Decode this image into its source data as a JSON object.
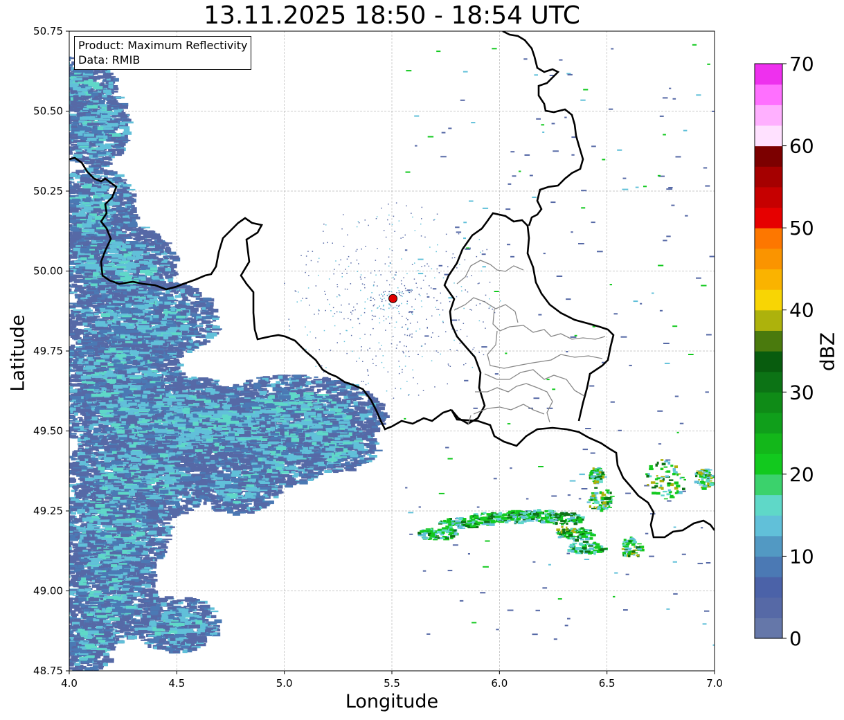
{
  "title": "13.11.2025 18:50 - 18:54 UTC",
  "info_box": {
    "product_line": "Product: Maximum Reflectivity",
    "data_line": "Data: RMIB"
  },
  "axes": {
    "xlabel": "Longitude",
    "ylabel": "Latitude",
    "xlim": [
      4.0,
      7.0
    ],
    "ylim": [
      48.75,
      50.75
    ],
    "xticks": [
      "4.0",
      "4.5",
      "5.0",
      "5.5",
      "6.0",
      "6.5",
      "7.0"
    ],
    "yticks": [
      "48.75",
      "49.00",
      "49.25",
      "49.50",
      "49.75",
      "50.00",
      "50.25",
      "50.50",
      "50.75"
    ],
    "grid": true
  },
  "colorbar": {
    "label": "dBZ",
    "min": 0,
    "max": 70,
    "step": 2.5,
    "ticks": [
      "0",
      "10",
      "20",
      "30",
      "40",
      "50",
      "60",
      "70"
    ],
    "colors": [
      "#6577a9",
      "#5669a6",
      "#4b62a8",
      "#4b79b4",
      "#5299c3",
      "#61c0d9",
      "#5fd8c8",
      "#3bd26c",
      "#12c91e",
      "#13b71a",
      "#109f1b",
      "#0f8b17",
      "#0c7315",
      "#085c0e",
      "#4a7a0d",
      "#adb20c",
      "#f8d504",
      "#fab300",
      "#fa9400",
      "#fd7700",
      "#e60000",
      "#c60000",
      "#a50000",
      "#7c0000",
      "#ffe1ff",
      "#ffb0ff",
      "#ff70ff",
      "#ee30ee"
    ]
  },
  "map": {
    "radar_site": {
      "lon": 5.505,
      "lat": 49.914,
      "color": "#e00000"
    },
    "echo_colors": {
      "weak": "#5669a6",
      "moderate": "#4b79b4",
      "light": "#61c0d9",
      "teal": "#5fd8c8",
      "green": "#12c91e",
      "dark_green": "#0c7315",
      "yellow": "#adb20c"
    }
  }
}
